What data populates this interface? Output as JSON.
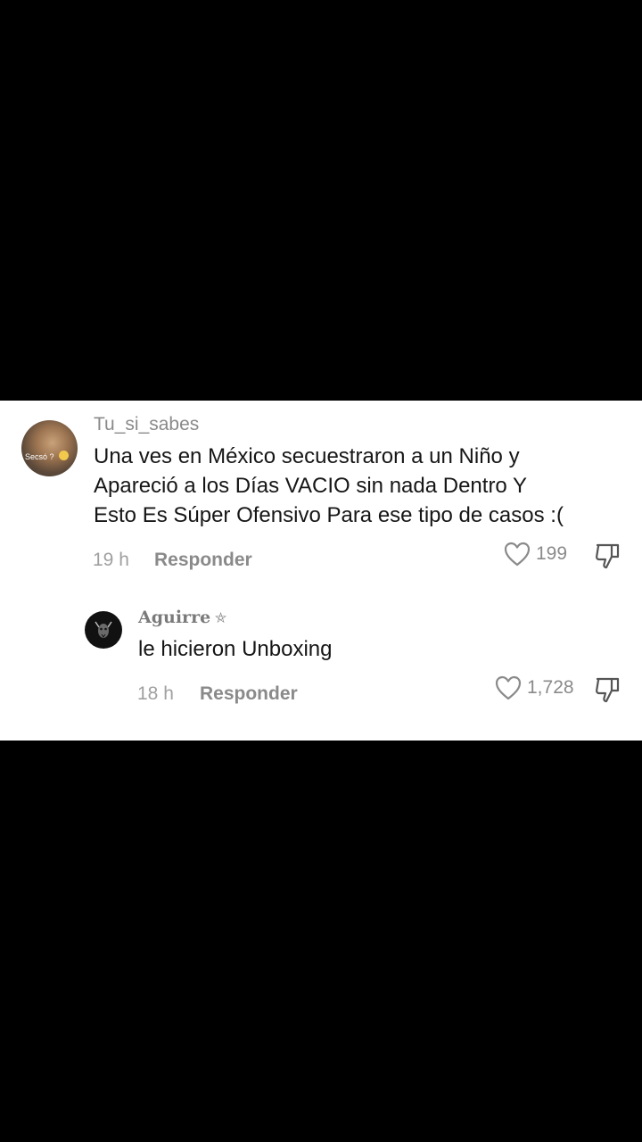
{
  "comment": {
    "username": "Tu_si_sabes",
    "avatar_caption": "Secsó ?",
    "lines": [
      "Una ves en México secuestraron a un Niño y",
      "Apareció a los Días VACIO sin nada Dentro Y",
      "Esto Es Súper Ofensivo Para ese tipo de casos :("
    ],
    "time": "19 h",
    "reply_label": "Responder",
    "likes": "199",
    "like_icon": "heart-outline-icon",
    "dislike_icon": "thumbs-down-icon"
  },
  "reply": {
    "username": "Aguirre",
    "username_symbol": "⛤",
    "text": "le hicieron Unboxing",
    "time": "18 h",
    "reply_label": "Responder",
    "likes": "1,728",
    "like_icon": "heart-outline-icon",
    "dislike_icon": "thumbs-down-icon"
  },
  "colors": {
    "background": "#000000",
    "panel": "#ffffff",
    "text": "#161616",
    "muted": "#8a8a8a"
  }
}
